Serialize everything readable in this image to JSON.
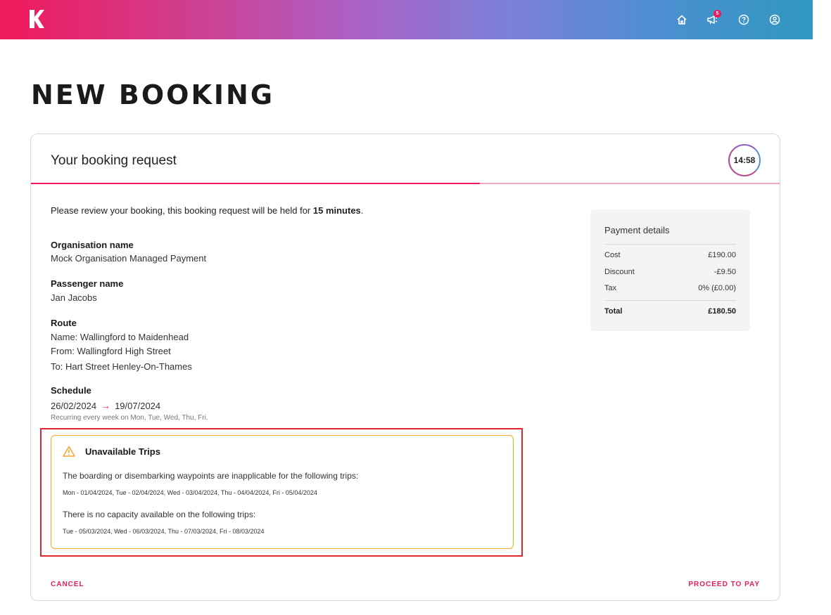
{
  "header": {
    "logo_letter": "K",
    "notification_count": "5",
    "icons": [
      "home-icon",
      "megaphone-icon",
      "help-icon",
      "account-icon"
    ]
  },
  "page": {
    "title": "NEW BOOKING"
  },
  "card": {
    "title": "Your booking request",
    "timer": "14:58",
    "progress": 0.6
  },
  "intro": {
    "prefix": "Please review your booking, this booking request will be held for ",
    "bold": "15 minutes",
    "suffix": "."
  },
  "organisation": {
    "label": "Organisation name",
    "value": "Mock Organisation Managed Payment"
  },
  "passenger": {
    "label": "Passenger name",
    "value": "Jan Jacobs"
  },
  "route": {
    "label": "Route",
    "name": "Name: Wallingford to Maidenhead",
    "from": "From: Wallingford High Street",
    "to": "To: Hart Street Henley-On-Thames"
  },
  "schedule": {
    "label": "Schedule",
    "start": "26/02/2024",
    "end": "19/07/2024",
    "recurrence": "Recurring every week on Mon, Tue, Wed, Thu, Fri."
  },
  "unavailable": {
    "title": "Unavailable Trips",
    "waypoints_text": "The boarding or disembarking waypoints are inapplicable for the following trips:",
    "waypoints_trips": "Mon - 01/04/2024, Tue - 02/04/2024, Wed - 03/04/2024, Thu - 04/04/2024, Fri - 05/04/2024",
    "capacity_text": "There is no capacity available on the following trips:",
    "capacity_trips": "Tue - 05/03/2024, Wed - 06/03/2024, Thu - 07/03/2024, Fri - 08/03/2024"
  },
  "payment": {
    "title": "Payment details",
    "rows": [
      {
        "label": "Cost",
        "value": "£190.00"
      },
      {
        "label": "Discount",
        "value": "-£9.50"
      },
      {
        "label": "Tax",
        "value": "0% (£0.00)"
      }
    ],
    "total": {
      "label": "Total",
      "value": "£180.50"
    }
  },
  "actions": {
    "cancel": "CANCEL",
    "proceed": "PROCEED TO PAY"
  },
  "colors": {
    "accent": "#f0195a",
    "warning": "#f4a62a",
    "highlight": "#e0262f"
  }
}
